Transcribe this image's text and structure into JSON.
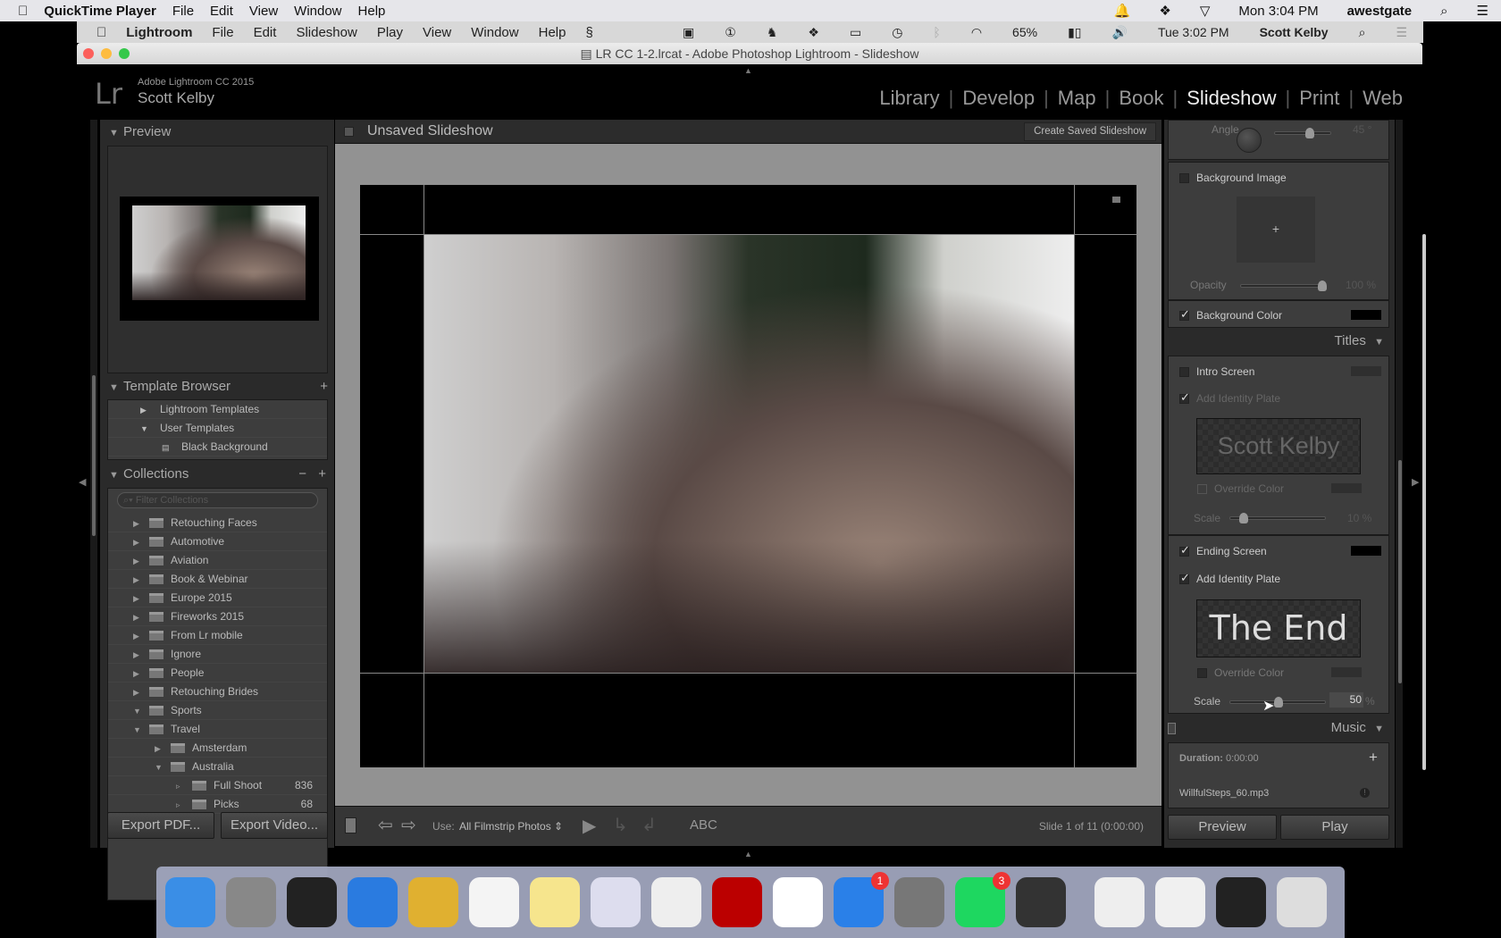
{
  "mac_menubar": {
    "app": "QuickTime Player",
    "items": [
      "File",
      "Edit",
      "View",
      "Window",
      "Help"
    ],
    "clock": "Mon 3:04 PM",
    "user": "awestgate"
  },
  "lr_menubar": {
    "app": "Lightroom",
    "items": [
      "File",
      "Edit",
      "Slideshow",
      "Play",
      "View",
      "Window",
      "Help"
    ],
    "battery": "65%",
    "clock": "Tue 3:02 PM",
    "user": "Scott Kelby"
  },
  "window": {
    "title": "LR CC 1-2.lrcat - Adobe Photoshop Lightroom - Slideshow"
  },
  "identity": {
    "logo": "Lr",
    "product": "Adobe Lightroom CC 2015",
    "name": "Scott Kelby"
  },
  "modules": [
    {
      "label": "Library"
    },
    {
      "label": "Develop"
    },
    {
      "label": "Map"
    },
    {
      "label": "Book"
    },
    {
      "label": "Slideshow",
      "active": true
    },
    {
      "label": "Print"
    },
    {
      "label": "Web"
    }
  ],
  "left_panel": {
    "preview_title": "Preview",
    "template_browser": {
      "title": "Template Browser",
      "items": [
        {
          "label": "Lightroom Templates",
          "expanded": false,
          "level": 0
        },
        {
          "label": "User Templates",
          "expanded": true,
          "level": 0
        },
        {
          "label": "Black Background",
          "level": 1
        }
      ]
    },
    "collections": {
      "title": "Collections",
      "filter_placeholder": "Filter Collections",
      "items": [
        {
          "label": "Retouching Faces",
          "level": 0,
          "expanded": false
        },
        {
          "label": "Automotive",
          "level": 0,
          "expanded": false
        },
        {
          "label": "Aviation",
          "level": 0,
          "expanded": false
        },
        {
          "label": "Book & Webinar",
          "level": 0,
          "expanded": false
        },
        {
          "label": "Europe 2015",
          "level": 0,
          "expanded": false
        },
        {
          "label": "Fireworks 2015",
          "level": 0,
          "expanded": false
        },
        {
          "label": "From Lr mobile",
          "level": 0,
          "expanded": false
        },
        {
          "label": "Ignore",
          "level": 0,
          "expanded": false
        },
        {
          "label": "People",
          "level": 0,
          "expanded": false
        },
        {
          "label": "Retouching Brides",
          "level": 0,
          "expanded": false
        },
        {
          "label": "Sports",
          "level": 0,
          "expanded": true
        },
        {
          "label": "Travel",
          "level": 0,
          "expanded": true
        },
        {
          "label": "Amsterdam",
          "level": 1,
          "expanded": false
        },
        {
          "label": "Australia",
          "level": 1,
          "expanded": true
        },
        {
          "label": "Full Shoot",
          "level": 2,
          "count": "836"
        },
        {
          "label": "Picks",
          "level": 2,
          "count": "68"
        }
      ]
    },
    "export_pdf": "Export PDF...",
    "export_video": "Export Video..."
  },
  "center": {
    "title": "Unsaved Slideshow",
    "create_saved": "Create Saved Slideshow",
    "toolbar": {
      "use_label": "Use:",
      "use_value": "All Filmstrip Photos",
      "text_tool": "ABC",
      "status": "Slide 1 of 11 (0:00:00)"
    }
  },
  "right_panel": {
    "angle_label": "Angle",
    "angle_value": "45 °",
    "background_image": {
      "label": "Background Image",
      "checked": false
    },
    "opacity_label": "Opacity",
    "opacity_value": "100 %",
    "opacity": 1.0,
    "background_color": {
      "label": "Background Color",
      "checked": true,
      "color": "#000000"
    },
    "titles_header": "Titles",
    "intro": {
      "label": "Intro Screen",
      "checked": false,
      "identity_label": "Add Identity Plate",
      "identity_checked": true,
      "plate_text": "Scott Kelby",
      "override_label": "Override Color",
      "scale_label": "Scale",
      "scale_value": "10 %",
      "scale": 0.1
    },
    "ending": {
      "label": "Ending Screen",
      "checked": true,
      "color": "#000000",
      "identity_label": "Add Identity Plate",
      "identity_checked": true,
      "plate_text": "The End",
      "override_label": "Override Color",
      "scale_label": "Scale",
      "scale_value": "50",
      "scale_unit": "%",
      "scale": 0.5
    },
    "music_header": "Music",
    "duration_label": "Duration:",
    "duration_value": "0:00:00",
    "music_file": "WillfulSteps_60.mp3",
    "preview_button": "Preview",
    "play_button": "Play"
  },
  "dock": [
    {
      "name": "finder",
      "color": "#3a8ee6"
    },
    {
      "name": "launchpad",
      "color": "#888"
    },
    {
      "name": "mission-control",
      "color": "#222"
    },
    {
      "name": "safari",
      "color": "#2a7be0"
    },
    {
      "name": "chrome",
      "color": "#e0b030"
    },
    {
      "name": "reminders",
      "color": "#f4f4f4"
    },
    {
      "name": "notes",
      "color": "#f6e58d"
    },
    {
      "name": "preview",
      "color": "#dde"
    },
    {
      "name": "photos",
      "color": "#eee"
    },
    {
      "name": "filezilla",
      "color": "#b00"
    },
    {
      "name": "video-editor",
      "color": "#fff"
    },
    {
      "name": "app-store",
      "color": "#2a80e8",
      "badge": "1"
    },
    {
      "name": "system-preferences",
      "color": "#777"
    },
    {
      "name": "spotify",
      "color": "#1ed760",
      "badge": "3"
    },
    {
      "name": "quicktime",
      "color": "#333"
    },
    {
      "name": "document",
      "color": "#eee"
    },
    {
      "name": "spreadsheet",
      "color": "#f0f0f0"
    },
    {
      "name": "screenshot",
      "color": "#222"
    },
    {
      "name": "trash",
      "color": "#ddd"
    }
  ]
}
